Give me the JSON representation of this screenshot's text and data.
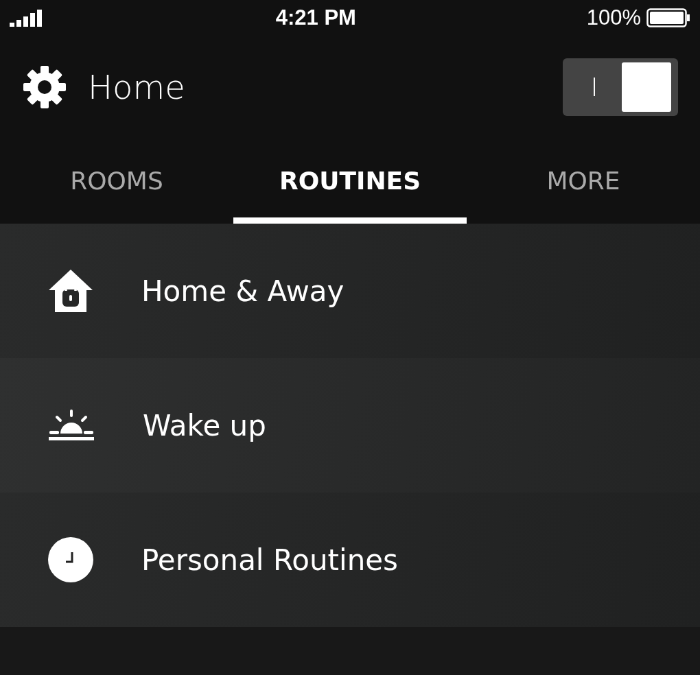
{
  "status_bar": {
    "time": "4:21 PM",
    "battery": "100%"
  },
  "header": {
    "title": "Home",
    "toggle": {
      "label": "I",
      "on": true
    }
  },
  "tabs": [
    {
      "label": "ROOMS",
      "selected": false
    },
    {
      "label": "ROUTINES",
      "selected": true
    },
    {
      "label": "MORE",
      "selected": false
    }
  ],
  "routines": [
    {
      "kind": "home-lock",
      "label": "Home & Away"
    },
    {
      "kind": "sunrise",
      "label": "Wake up"
    },
    {
      "kind": "clock",
      "label": "Personal Routines"
    }
  ]
}
